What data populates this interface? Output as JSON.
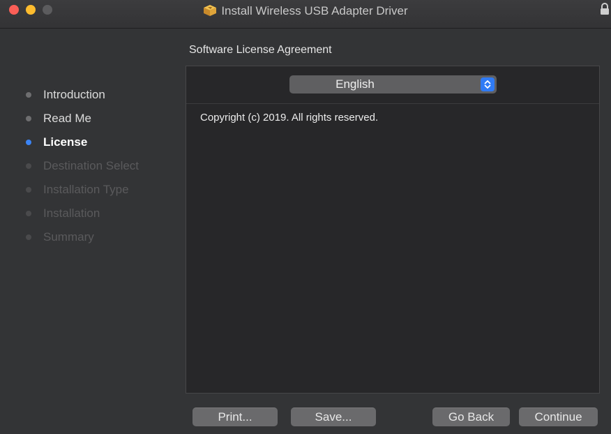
{
  "window": {
    "title": "Install Wireless USB Adapter Driver",
    "icons": {
      "package": "package-icon",
      "lock": "lock-icon"
    }
  },
  "sidebar": {
    "steps": [
      {
        "label": "Introduction",
        "state": "done"
      },
      {
        "label": "Read Me",
        "state": "done"
      },
      {
        "label": "License",
        "state": "current"
      },
      {
        "label": "Destination Select",
        "state": "pending"
      },
      {
        "label": "Installation Type",
        "state": "pending"
      },
      {
        "label": "Installation",
        "state": "pending"
      },
      {
        "label": "Summary",
        "state": "pending"
      }
    ]
  },
  "main": {
    "heading": "Software License Agreement",
    "language": {
      "selected": "English"
    },
    "license_text": "Copyright (c) 2019.  All rights reserved."
  },
  "buttons": {
    "print": "Print...",
    "save": "Save...",
    "go_back": "Go Back",
    "continue": "Continue"
  },
  "colors": {
    "accent": "#3b84f5",
    "background": "#333436",
    "content_bg": "#272729"
  }
}
